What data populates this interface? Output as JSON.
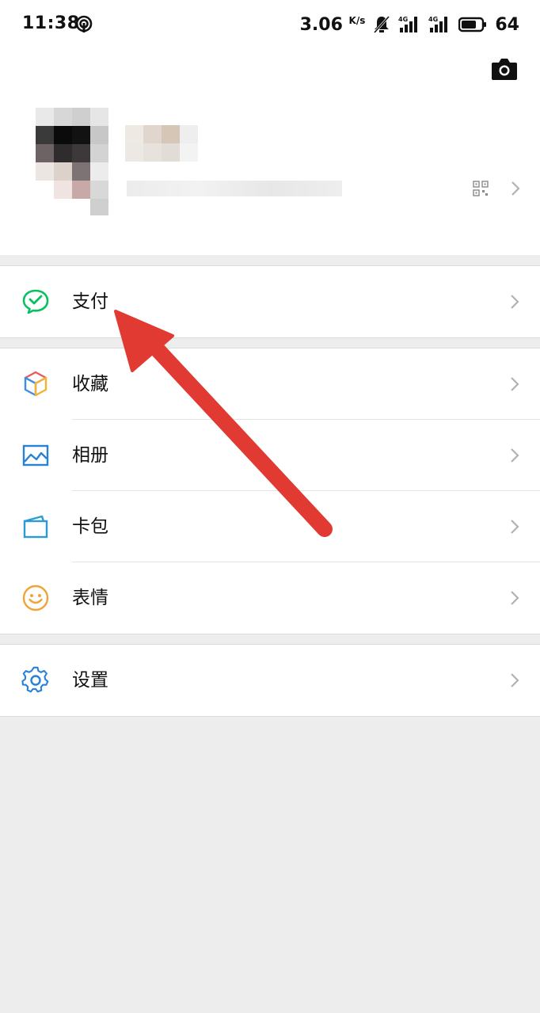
{
  "status_bar": {
    "time": "11:38",
    "speed_value": "3.06",
    "speed_unit": "K/s",
    "battery": "64",
    "network_label": "4G"
  },
  "profile": {
    "camera_icon": "camera-icon",
    "qr_icon": "qr-code-icon"
  },
  "menu": {
    "pay": "支付",
    "favorites": "收藏",
    "album": "相册",
    "cards": "卡包",
    "stickers": "表情",
    "settings": "设置"
  },
  "colors": {
    "pay_green": "#07c160",
    "arrow_red": "#e03a33",
    "settings_blue": "#2782d7",
    "sticker_orange": "#f0a33b"
  }
}
